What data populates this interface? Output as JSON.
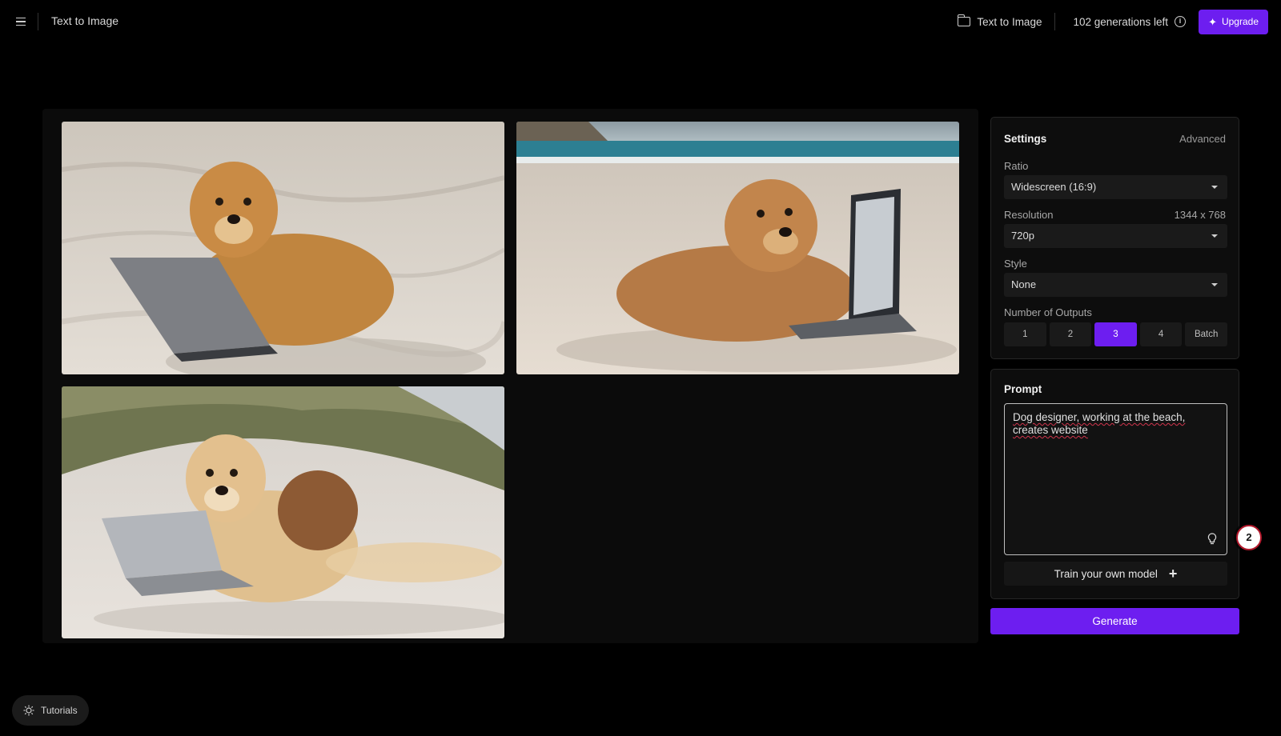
{
  "header": {
    "app_title": "Text to Image",
    "breadcrumb": "Text to Image",
    "generations_left": "102 generations left",
    "upgrade_label": "Upgrade"
  },
  "gallery": {
    "images": [
      {
        "icon": "dog-with-laptop-image"
      },
      {
        "icon": "dog-with-laptop-image"
      },
      {
        "icon": "dogs-with-laptop-image"
      }
    ]
  },
  "settings": {
    "title": "Settings",
    "advanced_label": "Advanced",
    "ratio_label": "Ratio",
    "ratio_value": "Widescreen (16:9)",
    "resolution_label": "Resolution",
    "resolution_dims": "1344 x 768",
    "resolution_value": "720p",
    "style_label": "Style",
    "style_value": "None",
    "outputs_label": "Number of Outputs",
    "outputs_options": [
      "1",
      "2",
      "3",
      "4",
      "Batch"
    ],
    "outputs_selected": "3"
  },
  "prompt": {
    "title": "Prompt",
    "value": "Dog designer, working at the beach,\ncreates website",
    "train_label": "Train your own model"
  },
  "generate_label": "Generate",
  "step_badge": "2",
  "tutorials_label": "Tutorials",
  "colors": {
    "accent": "#6d1ef0",
    "background": "#000000",
    "panel": "#0d0d0d",
    "badge_ring": "#b2182b"
  }
}
